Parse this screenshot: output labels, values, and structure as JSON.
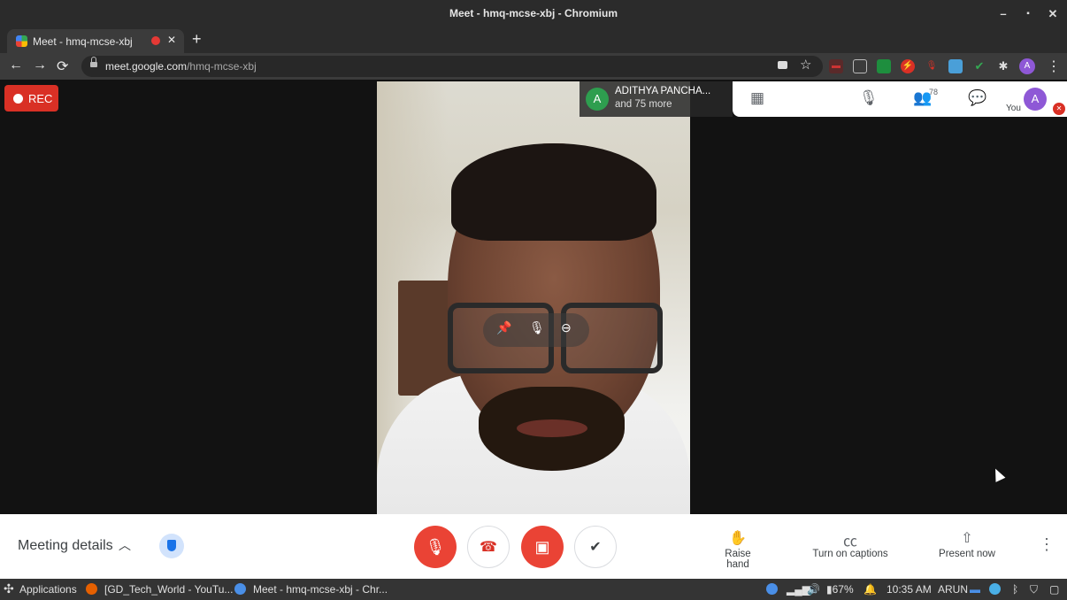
{
  "window": {
    "title": "Meet - hmq-mcse-xbj - Chromium"
  },
  "tab": {
    "label": "Meet - hmq-mcse-xbj",
    "close": "✕",
    "new": "+"
  },
  "toolbar": {
    "back": "←",
    "forward": "→",
    "reload": "⟳",
    "url_host": "meet.google.com",
    "url_path": "/hmq-mcse-xbj",
    "star": "☆",
    "menu": "⋮",
    "profile_initial": "A"
  },
  "meeting": {
    "rec_label": "REC",
    "participant_initial": "A",
    "participant_name": "ADITHYA PANCHA...",
    "participant_more": "and 75 more",
    "participant_count": "78",
    "you_label": "You",
    "you_initial": "A",
    "meeting_details": "Meeting details",
    "raise_hand": "Raise hand",
    "captions": "Turn on captions",
    "present": "Present now"
  },
  "taskbar": {
    "applications": "Applications",
    "youtube_window": "[GD_Tech_World - YouTu...",
    "meet_window": "Meet - hmq-mcse-xbj - Chr...",
    "battery": "67%",
    "time": "10:35 AM",
    "user": "ARUN"
  },
  "colors": {
    "accent_red": "#ea4335",
    "rec_red": "#d93025",
    "avatar_purple": "#8e58d6",
    "avatar_green": "#2e9e4f"
  }
}
